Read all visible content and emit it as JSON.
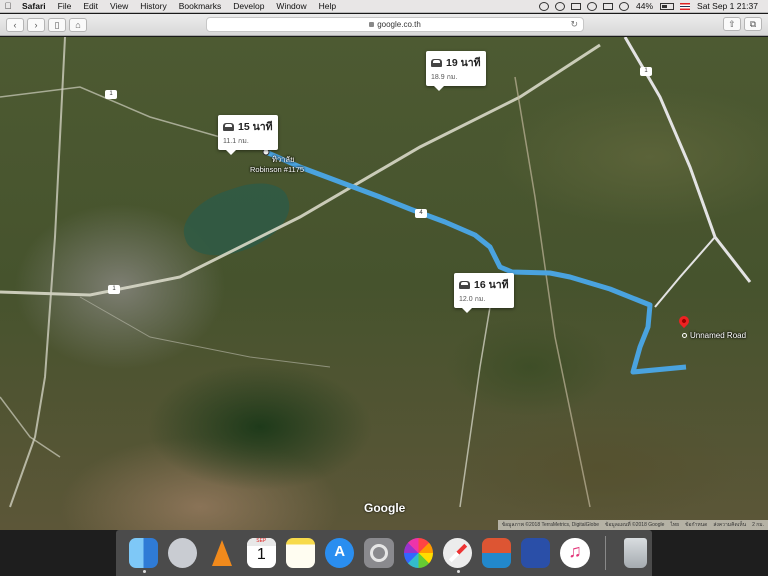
{
  "menubar": {
    "apple_icon": "apple-logo-icon",
    "items": [
      "Safari",
      "File",
      "Edit",
      "View",
      "History",
      "Bookmarks",
      "Develop",
      "Window",
      "Help"
    ],
    "battery": "44%",
    "clock": "Sat Sep 1  21:37"
  },
  "toolbar": {
    "back": "‹",
    "forward": "›",
    "url": "google.co.th"
  },
  "map": {
    "routes": [
      {
        "time": "15 นาที",
        "distance": "11.1 กม."
      },
      {
        "time": "19 นาที",
        "distance": "18.9 กม."
      },
      {
        "time": "16 นาที",
        "distance": "12.0 กม."
      }
    ],
    "places": [
      "ทิวาลัย",
      "Robinson #1175"
    ],
    "destination": "Unnamed Road",
    "road_numbers": [
      "1",
      "1",
      "4",
      "1"
    ],
    "logo": "Google",
    "attribution": [
      "ข้อมูลภาพ ©2018 TerraMetrics, DigitalGlobe",
      "ข้อมูลแผนที่ ©2018 Google",
      "ไทย",
      "ข้อกำหนด",
      "ส่งความคิดเห็น",
      "2 กม."
    ],
    "route_color": "#4aa3df"
  },
  "dock": {
    "calendar_month": "SEP",
    "calendar_day": "1",
    "items": [
      "finder-icon",
      "launchpad-icon",
      "vlc-icon",
      "calendar-icon",
      "notes-icon",
      "app-store-icon",
      "system-preferences-icon",
      "photos-icon",
      "safari-icon",
      "tv-icon",
      "calculator-icon",
      "itunes-icon",
      "trash-icon"
    ]
  }
}
